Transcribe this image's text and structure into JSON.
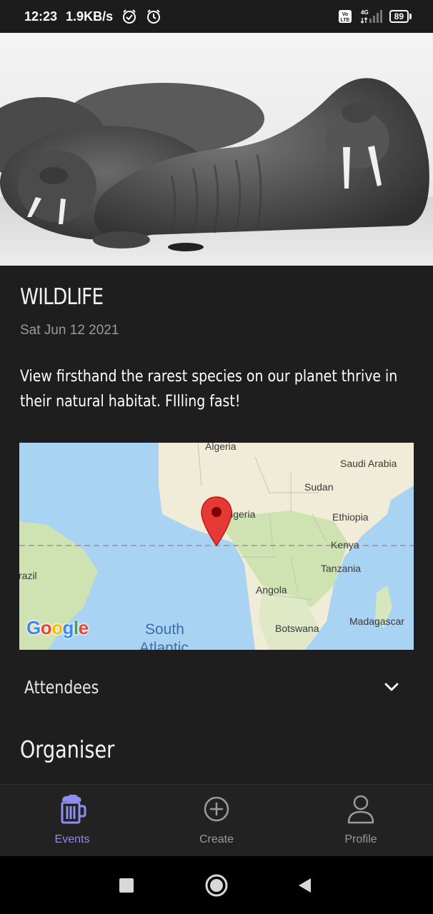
{
  "status_bar": {
    "time": "12:23",
    "network_speed": "1.9KB/s",
    "battery_level": "89",
    "volte_label": "Vo LTE",
    "network_type": "4G"
  },
  "event": {
    "title": "WILDLIFE",
    "date": "Sat Jun 12 2021",
    "description": "View firsthand the rarest species on our planet thrive in their natural habitat. FIlling fast!"
  },
  "map": {
    "labels": {
      "algeria": "Algeria",
      "saudi_arabia": "Saudi Arabia",
      "sudan": "Sudan",
      "nigeria": "Nigeria",
      "ethiopia": "Ethiopia",
      "kenya": "Kenya",
      "tanzania": "Tanzania",
      "brazil": "razil",
      "angola": "Angola",
      "madagascar": "Madagascar",
      "botswana": "Botswana",
      "ocean_line1": "South",
      "ocean_line2": "Atlantic"
    },
    "provider": "Google",
    "pin_color": "#e53935"
  },
  "sections": {
    "attendees_label": "Attendees",
    "organiser_label": "Organiser"
  },
  "bottom_nav": {
    "items": [
      {
        "label": "Events",
        "icon": "beer-mug-icon",
        "active": true
      },
      {
        "label": "Create",
        "icon": "plus-circle-icon",
        "active": false
      },
      {
        "label": "Profile",
        "icon": "person-icon",
        "active": false
      }
    ]
  },
  "colors": {
    "background": "#1e1e1e",
    "accent": "#8e8df0",
    "muted_text": "#9a9a9a"
  }
}
